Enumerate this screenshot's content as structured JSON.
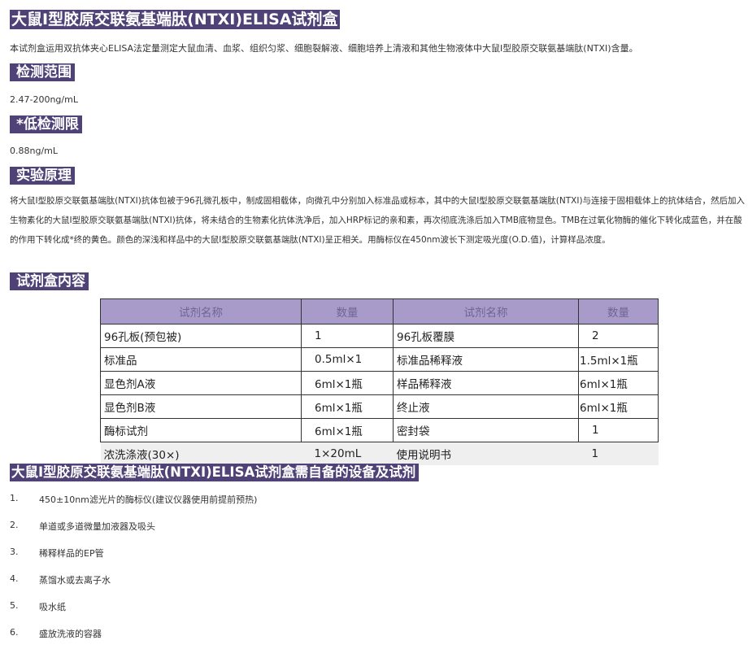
{
  "title": "大鼠Ⅰ型胶原交联氨基端肽(NTXⅠ)ELISA试剂盒",
  "intro": "本试剂盒运用双抗体夹心ELISA法定量测定大鼠血清、血浆、组织匀浆、细胞裂解液、细胞培养上清液和其他生物液体中大鼠Ⅰ型胶原交联氨基端肽(NTXⅠ)含量。",
  "range": {
    "heading": "检测范围",
    "value": "2.47-200ng/mL"
  },
  "sensitivity": {
    "heading": "*低检测限",
    "value": "0.88ng/mL"
  },
  "principle": {
    "heading": "实验原理",
    "text": "将大鼠Ⅰ型胶原交联氨基端肽(NTXⅠ)抗体包被于96孔微孔板中，制成固相载体，向微孔中分别加入标准品或标本，其中的大鼠Ⅰ型胶原交联氨基端肽(NTXⅠ)与连接于固相载体上的抗体结合，然后加入生物素化的大鼠Ⅰ型胶原交联氨基端肽(NTXⅠ)抗体，将未结合的生物素化抗体洗净后，加入HRP标记的亲和素，再次彻底洗涤后加入TMB底物显色。TMB在过氧化物酶的催化下转化成蓝色，并在酸的作用下转化成*终的黄色。颜色的深浅和样品中的大鼠Ⅰ型胶原交联氨基端肽(NTXⅠ)呈正相关。用酶标仪在450nm波长下测定吸光度(O.D.值)，计算样品浓度。"
  },
  "kit": {
    "heading": "试剂盒内容",
    "headers": [
      "试剂名称",
      "数量",
      "试剂名称",
      "数量"
    ],
    "rows": [
      [
        "96孔板(预包被)",
        "1",
        "96孔板覆膜",
        "2"
      ],
      [
        "标准品",
        "0.5ml×1",
        "标准品稀释液",
        "1.5ml×1瓶"
      ],
      [
        "显色剂A液",
        "6ml×1瓶",
        "样品稀释液",
        "6ml×1瓶"
      ],
      [
        "显色剂B液",
        "6ml×1瓶",
        "终止液",
        "6ml×1瓶"
      ],
      [
        "酶标试剂",
        "6ml×1瓶",
        "密封袋",
        "1"
      ],
      [
        "浓洗涤液(30×)",
        "1×20mL",
        "使用说明书",
        "1"
      ]
    ]
  },
  "equipment": {
    "heading": "大鼠Ⅰ型胶原交联氨基端肽(NTXⅠ)ELISA试剂盒需自备的设备及试剂",
    "items": [
      {
        "num": "1.",
        "text": "450±10nm滤光片的酶标仪(建议仪器使用前提前预热)"
      },
      {
        "num": "2.",
        "text": "单道或多道微量加液器及吸头"
      },
      {
        "num": "3.",
        "text": "稀释样品的EP管"
      },
      {
        "num": "4.",
        "text": "蒸馏水或去离子水"
      },
      {
        "num": "5.",
        "text": "吸水纸"
      },
      {
        "num": "6.",
        "text": "盛放洗液的容器"
      }
    ]
  },
  "colors": {
    "heading_bg": "#4e4277",
    "table_header_bg": "#a99bc9",
    "table_header_text": "#6e6593"
  }
}
